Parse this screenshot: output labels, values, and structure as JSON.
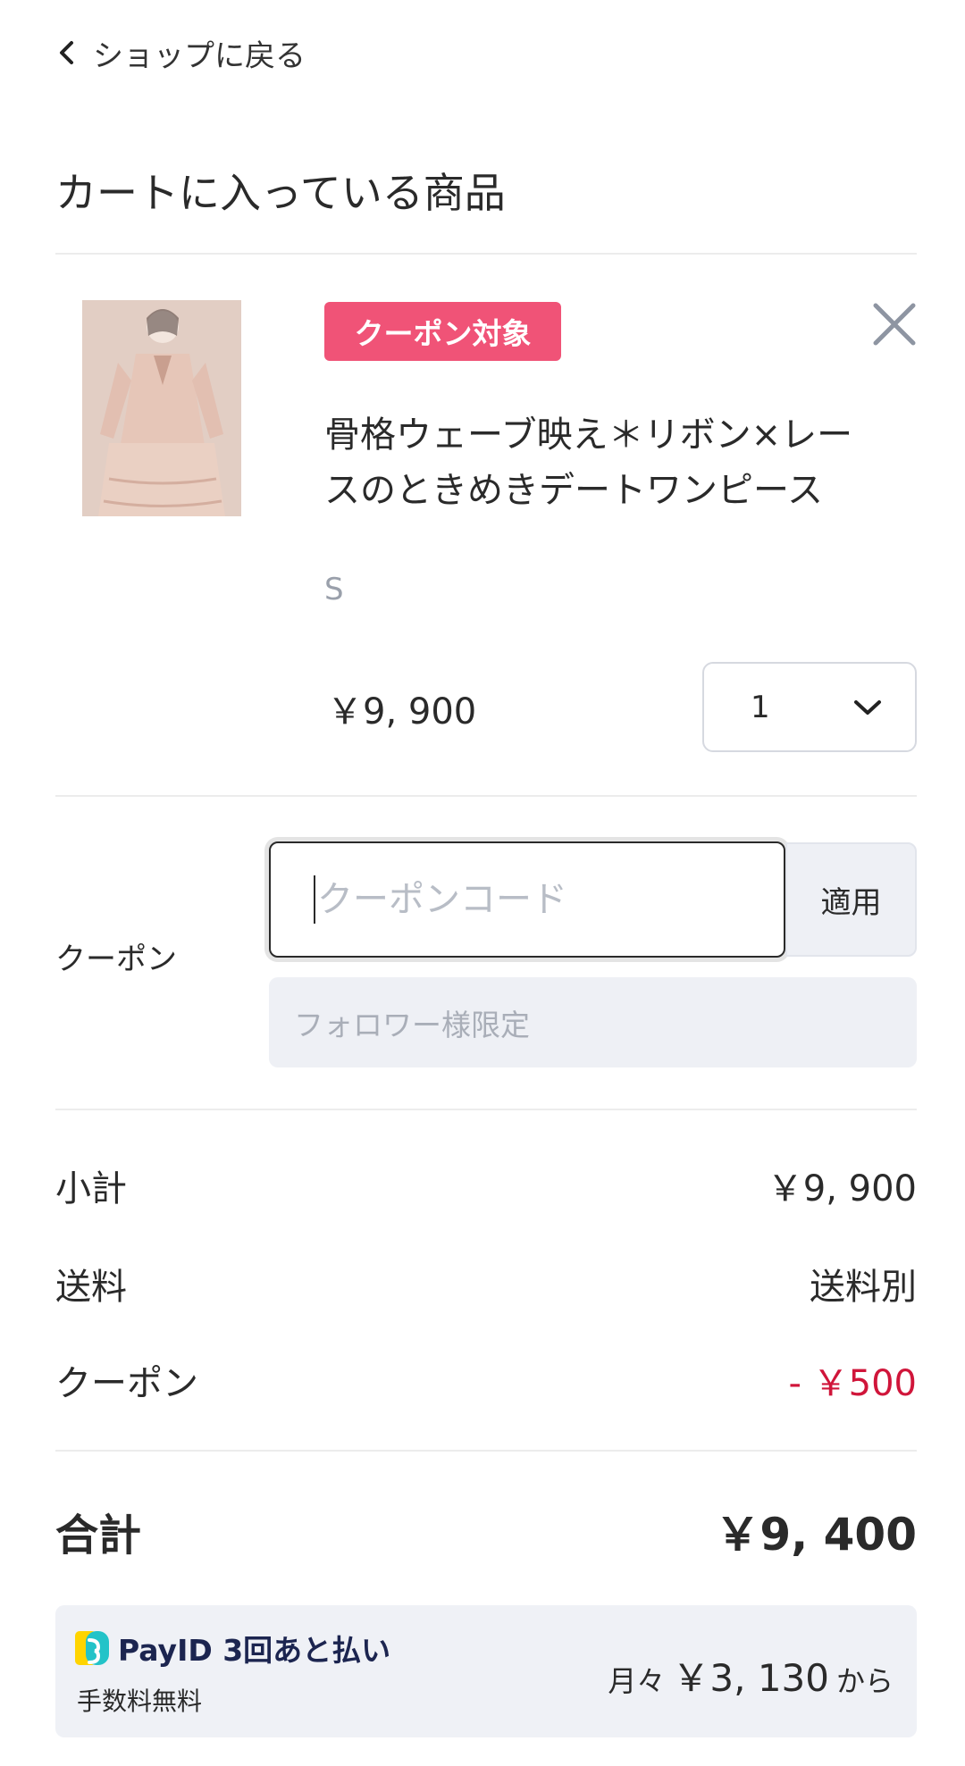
{
  "nav": {
    "back_label": "ショップに戻る"
  },
  "cart": {
    "title": "カートに入っている商品",
    "item": {
      "badge": "クーポン対象",
      "name": "骨格ウェーブ映え＊リボン×レースのときめきデートワンピース",
      "variant": "S",
      "price": "￥9, 900",
      "quantity": "1"
    }
  },
  "coupon": {
    "label": "クーポン",
    "placeholder": "クーポンコード",
    "apply_label": "適用",
    "note": "フォロワー様限定"
  },
  "summary": {
    "subtotal_label": "小計",
    "subtotal_value": "￥9, 900",
    "shipping_label": "送料",
    "shipping_value": "送料別",
    "coupon_label": "クーポン",
    "coupon_value": "- ￥500",
    "total_label": "合計",
    "total_value": "￥9, 400"
  },
  "payid": {
    "title": "PayID 3回あと払い",
    "subtitle": "手数料無料",
    "prefix": "月々",
    "amount": "￥3, 130",
    "suffix": "から"
  },
  "colors": {
    "badge": "#f05377",
    "discount": "#d0153a",
    "panel": "#eef0f5"
  }
}
